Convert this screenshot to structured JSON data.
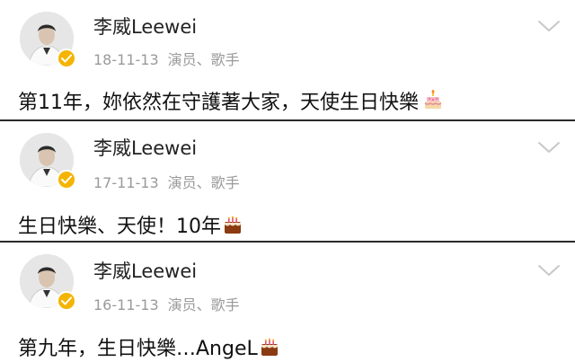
{
  "posts": [
    {
      "author": "李威Leewei",
      "date": "18-11-13",
      "tag": "演员、歌手",
      "text": "第11年，妳依然在守護著大家，天使生日快樂",
      "emoji": "birthday-cake-icon"
    },
    {
      "author": "李威Leewei",
      "date": "17-11-13",
      "tag": "演员、歌手",
      "text": "生日快樂、天使！10年",
      "emoji": "cake-icon"
    },
    {
      "author": "李威Leewei",
      "date": "16-11-13",
      "tag": "演员、歌手",
      "text": "第九年，生日快樂…AngeL",
      "emoji": "cake-icon"
    }
  ],
  "colors": {
    "verified_badge": "#f4b400",
    "meta_text": "#9a9a9a",
    "divider": "#2a2a2a"
  }
}
